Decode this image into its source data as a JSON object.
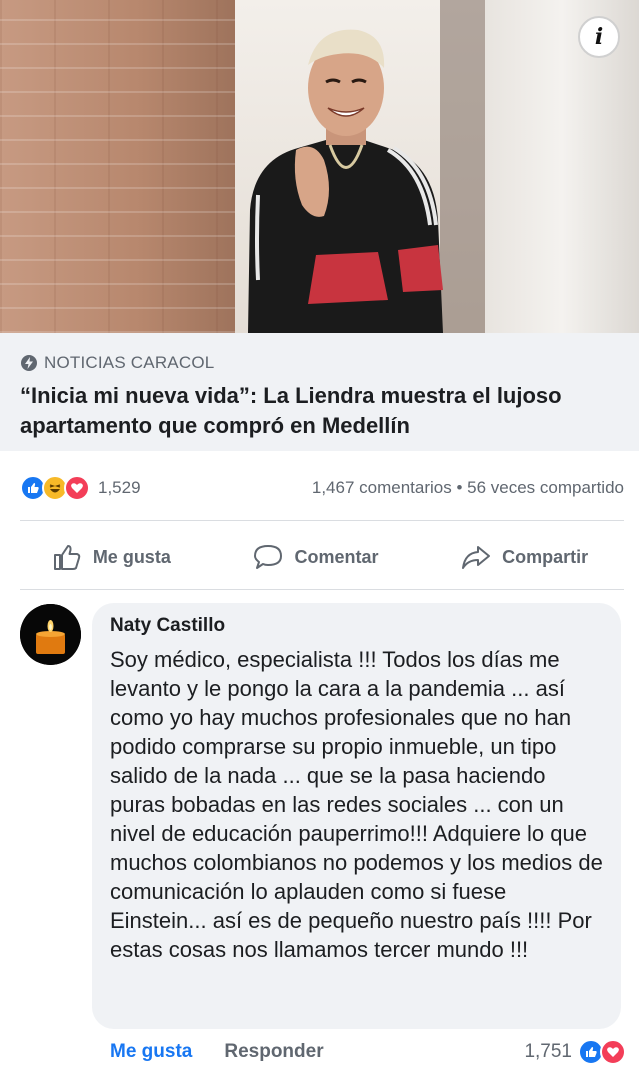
{
  "info_button": {
    "label": "i"
  },
  "preview": {
    "source": "NOTICIAS CARACOL",
    "headline": "“Inicia mi nueva vida”: La Liendra muestra el lujoso apartamento que compró en Medellín"
  },
  "stats": {
    "reactions": [
      "like",
      "haha",
      "love"
    ],
    "reaction_count": "1,529",
    "comments_shares": "1,467 comentarios • 56 veces compartido"
  },
  "actions": {
    "like": "Me gusta",
    "comment": "Comentar",
    "share": "Compartir"
  },
  "comment": {
    "author": "Naty Castillo",
    "text": "Soy médico, especialista !!! Todos los días me levanto y le pongo la cara a la pandemia ... así como yo hay muchos profesionales que no han podido comprarse su propio inmueble, un tipo salido de la nada ... que se la pasa haciendo puras bobadas en las redes sociales ... con un nivel de educación pauperrimo!!! Adquiere lo que muchos colombianos no podemos y los medios de comunicación lo aplauden como si fuese Einstein... así es de pequeño nuestro país !!!! Por estas cosas nos llamamos tercer mundo !!!",
    "like_link": "Me gusta",
    "reply_link": "Responder",
    "reaction_count": "1,751",
    "reactions": [
      "like",
      "love"
    ]
  },
  "colors": {
    "accent": "#1877f2",
    "muted_text": "#606770",
    "bubble_bg": "#f0f2f5"
  }
}
